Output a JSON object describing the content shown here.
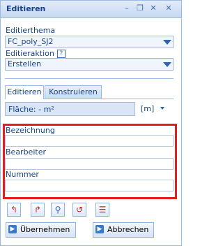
{
  "window": {
    "title": "Editieren"
  },
  "titlebar_tools": [
    {
      "name": "collapse-icon",
      "glyph": "–"
    },
    {
      "name": "restore-icon",
      "glyph": "❐"
    },
    {
      "name": "pin-icon",
      "glyph": "✕"
    },
    {
      "name": "close-icon",
      "glyph": "✕"
    }
  ],
  "theme": {
    "label": "Editierthema",
    "value": "FC_poly_SJ2"
  },
  "action": {
    "label": "Editieraktion",
    "help": "?",
    "value": "Erstellen"
  },
  "tabs": [
    {
      "label": "Editieren",
      "active": true
    },
    {
      "label": "Konstruieren",
      "active": false
    }
  ],
  "measure": {
    "value": "Fläche: - m²",
    "unit": "[m]"
  },
  "fields": [
    {
      "label": "Bezeichnung",
      "value": ""
    },
    {
      "label": "Bearbeiter",
      "value": ""
    },
    {
      "label": "Nummer",
      "value": ""
    }
  ],
  "tools": [
    {
      "name": "undo-icon",
      "glyph": "↰",
      "color": "#c82020"
    },
    {
      "name": "redo-icon",
      "glyph": "↱",
      "color": "#c82020"
    },
    {
      "name": "zoom-icon",
      "glyph": "⚲",
      "color": "#2a63b8"
    },
    {
      "name": "reset-icon",
      "glyph": "↺",
      "color": "#c82020"
    },
    {
      "name": "list-icon",
      "glyph": "☰",
      "color": "#c82020"
    }
  ],
  "buttons": {
    "apply": "Übernehmen",
    "cancel": "Abbrechen"
  },
  "colors": {
    "highlight": "#e02020",
    "accent": "#15428b"
  }
}
